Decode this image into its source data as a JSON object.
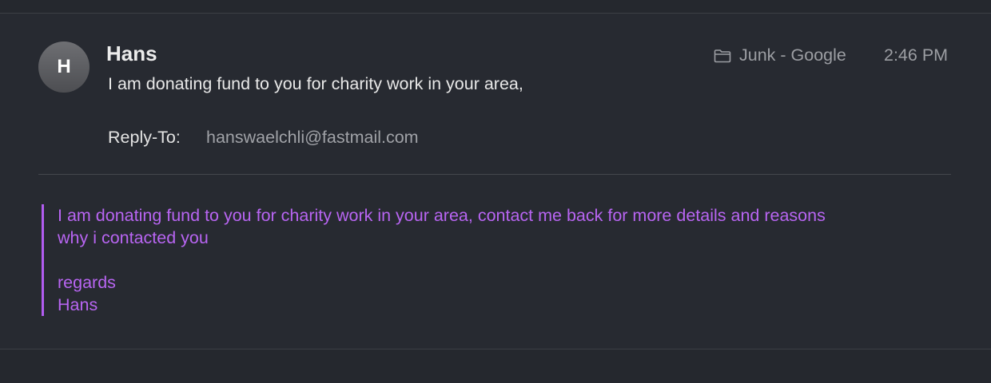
{
  "message": {
    "avatar_initial": "H",
    "sender_name": "Hans",
    "subject_preview": "I am donating fund to you for charity work in your area,",
    "mailbox": "Junk - Google",
    "time": "2:46 PM",
    "reply_to_label": "Reply-To:",
    "reply_to_address": "hanswaelchli@fastmail.com"
  },
  "body": {
    "line1": "I am donating fund to you for charity work in your area, contact me back for more details and reasons",
    "line2": "why i contacted you",
    "closing": "regards",
    "signature": "Hans"
  },
  "icons": {
    "mailbox": "folder-icon"
  },
  "colors": {
    "background": "#272a31",
    "quote_text": "#b865f2",
    "quote_bar": "#b25cf0"
  }
}
